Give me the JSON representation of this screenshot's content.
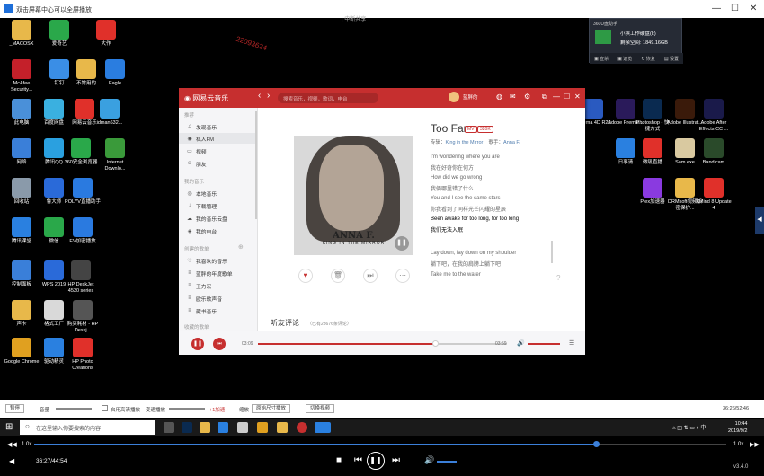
{
  "window": {
    "title": "双击屏幕中心可以全屏播放",
    "controls": [
      "—",
      "☐",
      "✕"
    ]
  },
  "center_hint": "| 中断共享",
  "watermark": "22093624",
  "desktop_icons": [
    {
      "label": "_MACOSX",
      "color": "#e8b84a"
    },
    {
      "label": "爱奇艺",
      "color": "#2aa84a"
    },
    {
      "label": "大作",
      "color": "#e0302a"
    },
    {
      "label": "McAfee Security...",
      "color": "#c4202a"
    },
    {
      "label": "钉钉",
      "color": "#3a8ee6"
    },
    {
      "label": "不常用的",
      "color": "#e8b84a"
    },
    {
      "label": "Eagle",
      "color": "#2a7de0"
    },
    {
      "label": "此电脑",
      "color": "#4a90d9"
    },
    {
      "label": "百度网盘",
      "color": "#3ab0e0"
    },
    {
      "label": "网易云音乐",
      "color": "#e0302a"
    },
    {
      "label": "idman632...",
      "color": "#3aa0e0"
    },
    {
      "label": "网络",
      "color": "#3a7fd9"
    },
    {
      "label": "腾讯QQ",
      "color": "#2aa0e0"
    },
    {
      "label": "360安全浏览器",
      "color": "#2aa84a"
    },
    {
      "label": "Internet Downlo...",
      "color": "#3a9a3a"
    },
    {
      "label": "回收站",
      "color": "#8a9aaa"
    },
    {
      "label": "鲁大师",
      "color": "#2a6ad9"
    },
    {
      "label": "POLYV直播助手",
      "color": "#2a7ae0"
    },
    {
      "label": "腾讯课堂",
      "color": "#2a80e0"
    },
    {
      "label": "微信",
      "color": "#2aa84a"
    },
    {
      "label": "EV加密播放",
      "color": "#2a7ae0"
    },
    {
      "label": "控制面板",
      "color": "#3a7fd9"
    },
    {
      "label": "WPS 2019",
      "color": "#2a6ad9"
    },
    {
      "label": "HP DeskJet 4530 series",
      "color": "#444"
    },
    {
      "label": "声卡",
      "color": "#e8b84a"
    },
    {
      "label": "格式工厂",
      "color": "#d9d9d9"
    },
    {
      "label": "购买耗材 - HP Deskj...",
      "color": "#555"
    },
    {
      "label": "Google Chrome",
      "color": "#e0a020"
    },
    {
      "label": "驱动精灵",
      "color": "#2a80e0"
    },
    {
      "label": "HP Photo Creations",
      "color": "#e0302a"
    },
    {
      "label": "Cinema 4D R20",
      "color": "#2a5ac0"
    },
    {
      "label": "Adobe Premie...",
      "color": "#2a1a5a"
    },
    {
      "label": "Photoshop - 快捷方式",
      "color": "#0a2a50"
    },
    {
      "label": "Adobe Illustrat...",
      "color": "#3a1a0a"
    },
    {
      "label": "Adobe After Effects CC ...",
      "color": "#1a1a4a"
    },
    {
      "label": "日事清",
      "color": "#2a80e0"
    },
    {
      "label": "微吼直播",
      "color": "#e0302a"
    },
    {
      "label": "Sam.exe",
      "color": "#d9c9a0"
    },
    {
      "label": "Bandicam",
      "color": "#2a4a2a"
    },
    {
      "label": "Plex加速器",
      "color": "#8a3ae0"
    },
    {
      "label": "DRMsoft视频加密保护...",
      "color": "#e8b84a"
    },
    {
      "label": "XMind 8 Update 4",
      "color": "#e0302a"
    }
  ],
  "widget": {
    "header": "360U盘助手",
    "line1": "小滨工作硬盘(I:)",
    "line2": "剩余空间: 1849.16GB",
    "buttons": [
      "▣ 查杀",
      "▣ 速览",
      "↻ 恢复",
      "▤ 设置"
    ]
  },
  "netease": {
    "logo": "◉ 网易云音乐",
    "search_placeholder": "搜索音乐，视频，歌词，电台",
    "username": "蓝胖的",
    "window_controls": [
      "⧉",
      "—",
      "☐",
      "✕"
    ],
    "sidebar": {
      "sec1": "推荐",
      "items1": [
        {
          "icon": "♫",
          "label": "发现音乐"
        },
        {
          "icon": "◉",
          "label": "私人FM"
        },
        {
          "icon": "▭",
          "label": "视频"
        },
        {
          "icon": "☺",
          "label": "朋友"
        }
      ],
      "sec2": "我的音乐",
      "items2": [
        {
          "icon": "◎",
          "label": "本地音乐"
        },
        {
          "icon": "↓",
          "label": "下载管理"
        },
        {
          "icon": "☁",
          "label": "我的音乐云盘"
        },
        {
          "icon": "◈",
          "label": "我的电台"
        }
      ],
      "sec3": "创建的歌单",
      "items3": [
        {
          "icon": "♡",
          "label": "我喜欢的音乐"
        },
        {
          "icon": "≡",
          "label": "蓝胖的年度歌单"
        },
        {
          "icon": "≡",
          "label": "王力宏"
        },
        {
          "icon": "≡",
          "label": "欧乐歌声音"
        },
        {
          "icon": "≡",
          "label": "藏书音乐"
        }
      ],
      "sec4": "收藏的歌单"
    },
    "cover": {
      "artist": "ANNA F.",
      "album": "KING IN THE MIRROR"
    },
    "song": {
      "title": "Too Far",
      "badge1": "MV",
      "badge2": "320K",
      "album_label": "专辑：",
      "album": "King in the Mirror",
      "artist_label": "歌手：",
      "artist": "Anna F."
    },
    "lyrics": [
      "I'm wondering where you are",
      "我在好奇你在何方",
      "How did we go wrong",
      "我俩哪里错了什么",
      "You and I see the same stars",
      "你我看到了同样光芒闪耀的星辰",
      "Been awake for too long, for too long",
      "我们无法入眠",
      "Lay down, lay down on my shoulder",
      "躺下吧，在我的肩膀上躺下吧",
      "Take me to the water"
    ],
    "comments_title": "听友评论",
    "comments_count": "（已有28676条评论）",
    "player": {
      "current": "03:09",
      "total": "03:59",
      "progress": 0.79
    }
  },
  "video_controls": {
    "pause": "暂停",
    "volume": "音量",
    "hd_caption": "启用高清播放",
    "speed": "变速播放",
    "speed_value": "+1加速",
    "scale": "缩放",
    "scale_value": "原始尺寸播放",
    "switch": "切换视频",
    "time": "36:26/52:46"
  },
  "taskbar": {
    "search": "在这里输入你要搜索的内容",
    "time": "10:44",
    "date": "2019/9/2"
  },
  "bottom_player": {
    "speed_left": "1.0x",
    "speed_right": "1.0x",
    "time": "36:27/44:54",
    "version": "v3.4.0",
    "progress": 0.81
  }
}
